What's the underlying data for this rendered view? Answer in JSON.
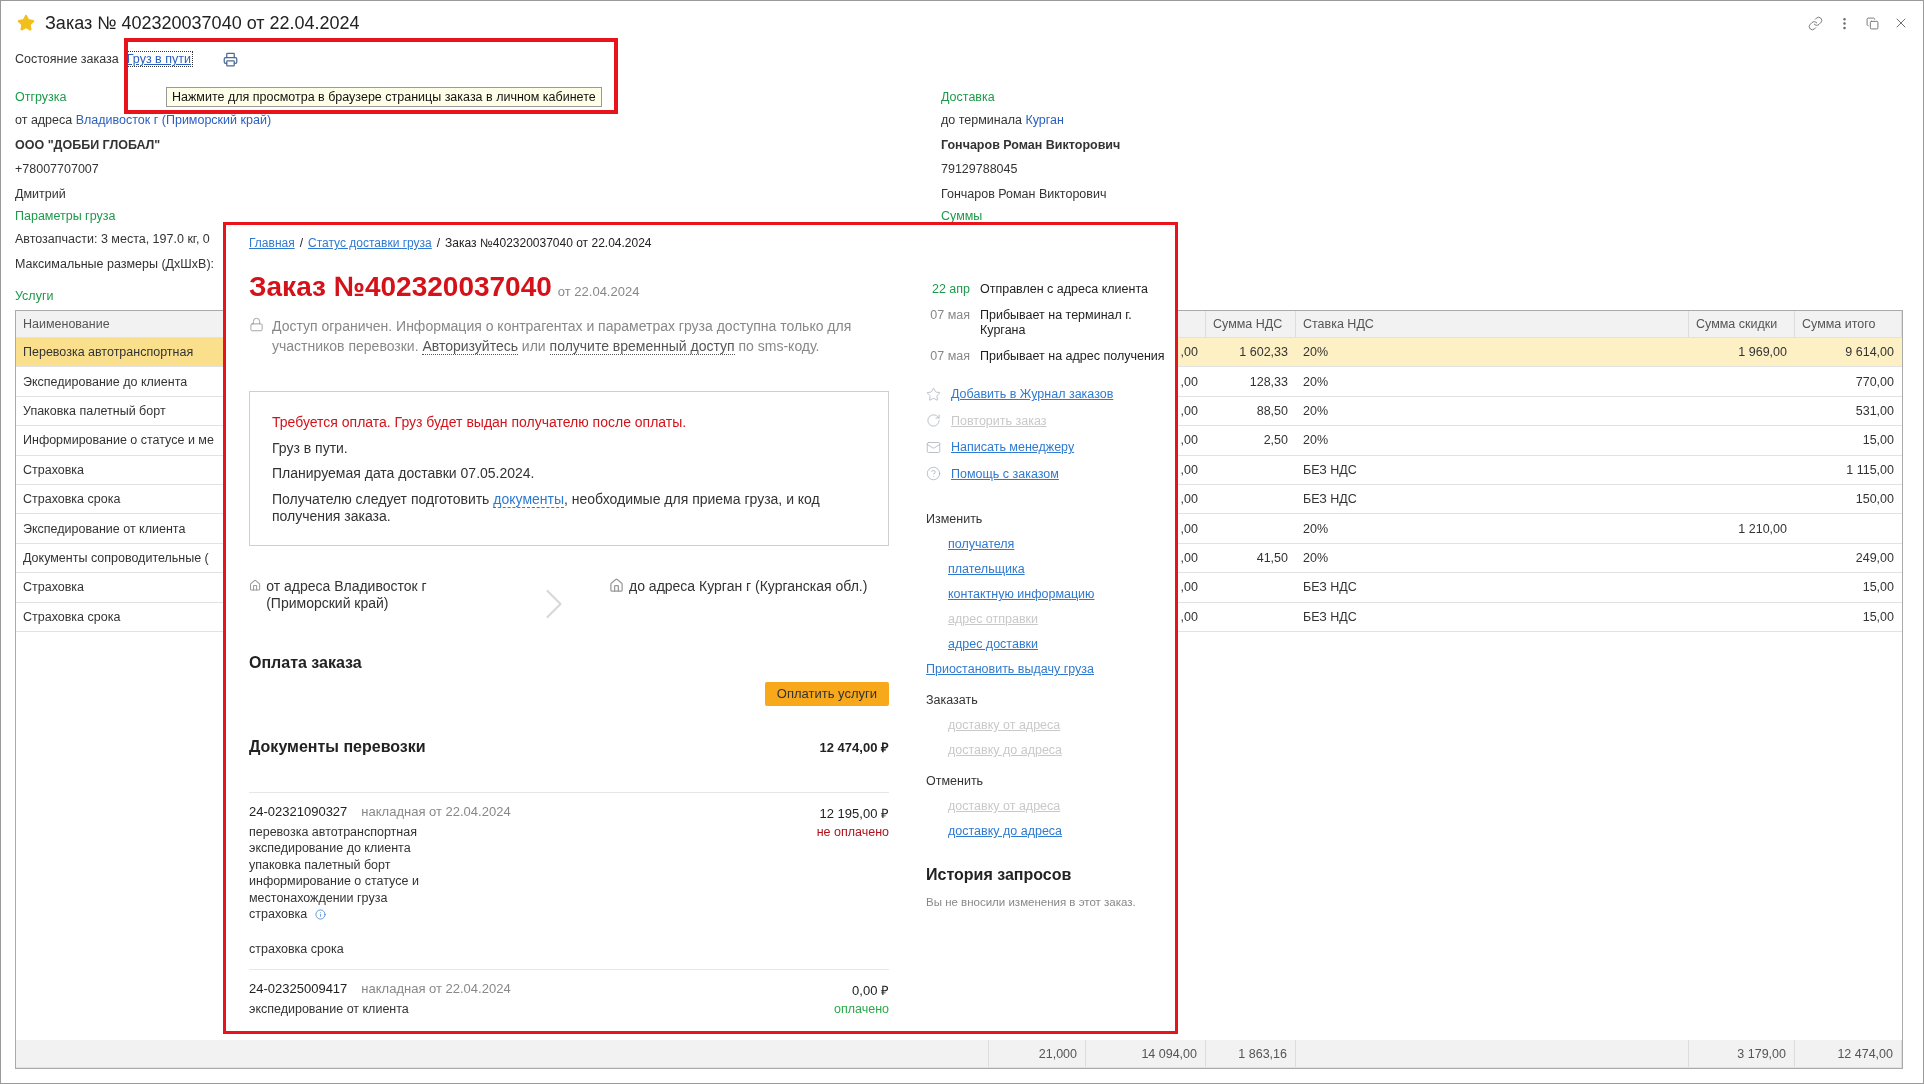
{
  "window": {
    "title": "Заказ № 402320037040 от 22.04.2024"
  },
  "status": {
    "label": "Состояние заказа",
    "value": "Груз в пути"
  },
  "tooltip": "Нажмите для просмотра в браузере страницы заказа в личном кабинете",
  "shipment": {
    "heading": "Отгрузка",
    "address_prefix": "от адреса",
    "address": "Владивосток г (Приморский край)",
    "company": "ООО \"ДОББИ ГЛОБАЛ\"",
    "phone": "+78007707007",
    "contact": "Дмитрий"
  },
  "cargo": {
    "heading": "Параметры груза",
    "lines": [
      "Автозапчасти: 3 места, 197.0 кг, 0",
      "Максимальные размеры (ДхШхВ):"
    ]
  },
  "delivery": {
    "heading": "Доставка",
    "address_prefix": "до терминала",
    "address": "Курган",
    "recipient": "Гончаров Роман Викторович",
    "phone": "79129788045",
    "contact": "Гончаров Роман Викторович",
    "sums_heading": "Суммы"
  },
  "services": {
    "heading": "Услуги",
    "columns": {
      "name": "Наименование",
      "vat": "Сумма НДС",
      "vat_rate": "Ставка НДС",
      "discount": "Сумма скидки",
      "total": "Сумма итого"
    },
    "rows": [
      {
        "name": "Перевозка автотранспортная",
        "column_3": ",00",
        "vat": "1 602,33",
        "vat_rate": "20%",
        "discount": "1 969,00",
        "total": "9 614,00",
        "selected": true
      },
      {
        "name": "Экспедирование до клиента",
        "column_3": ",00",
        "vat": "128,33",
        "vat_rate": "20%",
        "total": "770,00",
        "selected": false
      },
      {
        "name": "Упаковка палетный борт",
        "column_3": ",00",
        "vat": "88,50",
        "vat_rate": "20%",
        "total": "531,00",
        "selected": false
      },
      {
        "name": "Информирование о статусе и ме",
        "column_3": ",00",
        "vat": "2,50",
        "vat_rate": "20%",
        "total": "15,00",
        "selected": false
      },
      {
        "name": "Страховка",
        "column_3": ",00",
        "vat_rate": "БЕЗ НДС",
        "total": "1 115,00",
        "selected": false
      },
      {
        "name": "Страховка срока",
        "column_3": ",00",
        "vat_rate": "БЕЗ НДС",
        "total": "150,00",
        "selected": false
      },
      {
        "name": "Экспедирование от клиента",
        "column_3": ",00",
        "vat_rate": "20%",
        "discount": "1 210,00",
        "selected": false
      },
      {
        "name": "Документы сопроводительные (",
        "column_3": ",00",
        "vat": "41,50",
        "vat_rate": "20%",
        "total": "249,00",
        "selected": false
      },
      {
        "name": "Страховка",
        "column_3": ",00",
        "vat_rate": "БЕЗ НДС",
        "total": "15,00",
        "selected": false
      },
      {
        "name": "Страховка срока",
        "column_3": ",00",
        "vat_rate": "БЕЗ НДС",
        "total": "15,00",
        "selected": false
      }
    ],
    "footer": {
      "column_2": "21,000",
      "column_3": "14 094,00",
      "vat": "1 863,16",
      "discount": "3 179,00",
      "total": "12 474,00"
    }
  },
  "web_page": {
    "breadcrumbs": [
      {
        "label": "Главная",
        "link": true,
        "separator": "/"
      },
      {
        "label": "Статус доставки груза",
        "link": true,
        "separator": "/"
      },
      {
        "label": "Заказ №402320037040 от 22.04.2024",
        "link": false
      }
    ],
    "title": "Заказ №402320037040",
    "date": "от 22.04.2024",
    "notice": [
      {
        "text": "Доступ ограничен. Информация о контрагентах и параметрах груза доступна только для участников перевозки. "
      },
      {
        "text": "Авторизуйтесь",
        "link": true
      },
      {
        "text": " или "
      },
      {
        "text": "получите временный доступ",
        "link": true
      },
      {
        "text": " по sms-коду."
      }
    ],
    "status_box": [
      {
        "alert": true,
        "parts": [
          {
            "text": "Требуется оплата. Груз будет выдан получателю после оплаты."
          }
        ]
      },
      {
        "alert": false,
        "parts": [
          {
            "text": "Груз в пути."
          }
        ]
      },
      {
        "alert": false,
        "parts": [
          {
            "text": "Планируемая дата доставки 07.05.2024."
          }
        ]
      },
      {
        "alert": false,
        "parts": [
          {
            "text": "Получателю следует подготовить "
          },
          {
            "text": "документы",
            "link": true
          },
          {
            "text": ", необходимые для приема груза, и код получения заказа."
          }
        ]
      }
    ],
    "route": {
      "from": "от адреса Владивосток г (Приморский край)",
      "to": "до адреса Курган г (Курганская обл.)"
    },
    "payment": {
      "heading": "Оплата заказа",
      "button": "Оплатить услуги"
    },
    "documents": {
      "heading": "Документы перевозки",
      "total": "12 474,00 ₽",
      "items": [
        {
          "number": "24-02321090327",
          "type": "накладная от 22.04.2024",
          "amount": "12 195,00 ₽",
          "status": "не оплачено",
          "paid": false,
          "service_groups": [
            [
              {
                "text": "перевозка автотранспортная",
                "info": false
              },
              {
                "text": "экспедирование до клиента",
                "info": false
              },
              {
                "text": "упаковка палетный борт",
                "info": false
              },
              {
                "text": "информирование о статусе и местонахождении груза",
                "info": false
              },
              {
                "text": "страховка",
                "info": true
              }
            ],
            [
              {
                "text": "страховка срока",
                "info": false
              }
            ]
          ]
        },
        {
          "number": "24-02325009417",
          "type": "накладная от 22.04.2024",
          "amount": "0,00 ₽",
          "status": "оплачено",
          "paid": true,
          "service_groups": [
            [
              {
                "text": "экспедирование от клиента",
                "info": false
              }
            ]
          ]
        }
      ]
    },
    "timeline": [
      {
        "date": "22 апр",
        "event": "Отправлен с адреса клиента",
        "done": true
      },
      {
        "date": "07 мая",
        "event": "Прибывает на терминал г. Кургана",
        "done": false
      },
      {
        "date": "07 мая",
        "event": "Прибывает на адрес получения",
        "done": false
      }
    ],
    "actions": [
      {
        "kind": "star",
        "label": "Добавить в Журнал заказов",
        "disabled": false
      },
      {
        "kind": "repeat",
        "label": "Повторить заказ",
        "disabled": true
      },
      {
        "kind": "mail",
        "label": "Написать менеджеру",
        "disabled": false
      },
      {
        "kind": "help",
        "label": "Помощь с заказом",
        "disabled": false
      }
    ],
    "manage": [
      {
        "kind": "group",
        "heading": "Изменить",
        "links": [
          {
            "label": "получателя",
            "disabled": false
          },
          {
            "label": "плательщика",
            "disabled": false
          },
          {
            "label": "контактную информацию",
            "disabled": false
          },
          {
            "label": "адрес отправки",
            "disabled": true
          },
          {
            "label": "адрес доставки",
            "disabled": false
          }
        ]
      },
      {
        "kind": "link",
        "label": "Приостановить выдачу груза",
        "disabled": false
      },
      {
        "kind": "group",
        "heading": "Заказать",
        "links": [
          {
            "label": "доставку от адреса",
            "disabled": true
          },
          {
            "label": "доставку до адреса",
            "disabled": true
          }
        ]
      },
      {
        "kind": "group",
        "heading": "Отменить",
        "links": [
          {
            "label": "доставку от адреса",
            "disabled": true
          },
          {
            "label": "доставку до адреса",
            "disabled": false
          }
        ]
      }
    ],
    "history": {
      "heading": "История запросов",
      "text": "Вы не вносили изменения в этот заказ."
    }
  }
}
